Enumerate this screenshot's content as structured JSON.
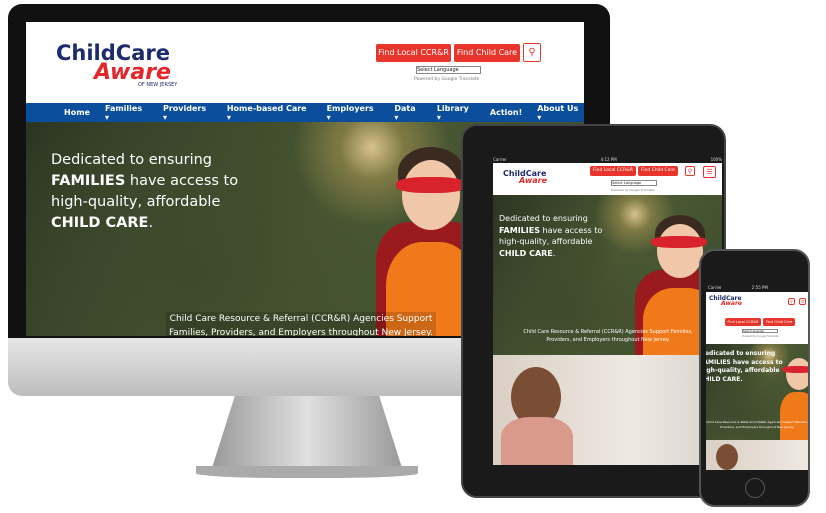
{
  "site": {
    "logo": {
      "line1": "ChildCare",
      "line2": "Aware",
      "line3": "OF NEW JERSEY"
    },
    "buttons": {
      "find_ccrr": "Find Local CCR&R",
      "find_care": "Find Child Care"
    },
    "search_icon": "magnifier-icon",
    "menu_icon": "hamburger-icon",
    "language_select": "Select Language",
    "powered_by": "Powered by Google Translate",
    "nav": [
      "Home",
      "Families ▾",
      "Providers ▾",
      "Home-based Care ▾",
      "Employers ▾",
      "Data ▾",
      "Library ▾",
      "Action!",
      "About Us ▾"
    ],
    "hero": {
      "l1": "Dedicated to ensuring",
      "l2a": "FAMILIES",
      "l2b": " have access to",
      "l3": "high-quality, affordable",
      "l4": "CHILD CARE",
      "l4b": "."
    },
    "subtitle": "Child Care Resource & Referral (CCR&R) Agencies Support Families, Providers, and Employers throughout New Jersey."
  },
  "tablet_status": {
    "carrier": "Carrier",
    "time": "4:12 PM",
    "battery": "100%"
  },
  "phone_status": {
    "carrier": "Carrier",
    "time": "2:55 PM"
  },
  "colors": {
    "nav": "#0b4f9c",
    "button": "#e8352c",
    "logo_blue": "#1d2a6b",
    "logo_red": "#e4262b"
  }
}
